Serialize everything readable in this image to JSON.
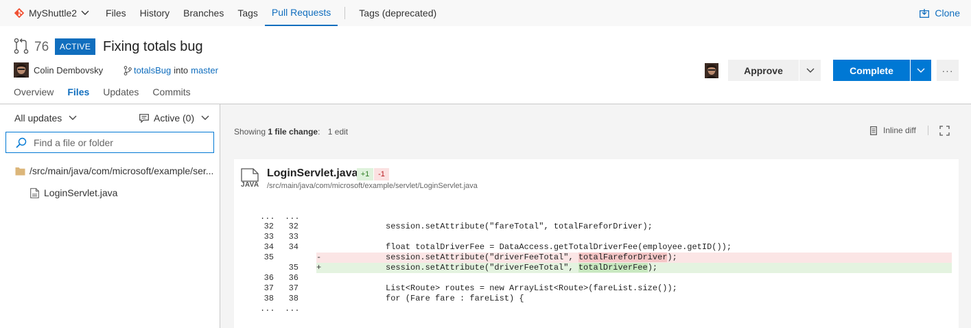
{
  "nav": {
    "project": "MyShuttle2",
    "items": [
      "Files",
      "History",
      "Branches",
      "Tags",
      "Pull Requests",
      "Tags (deprecated)"
    ],
    "active_index": 4,
    "clone_label": "Clone"
  },
  "pr": {
    "number": "76",
    "status": "ACTIVE",
    "title": "Fixing totals bug",
    "author": "Colin Dembovsky",
    "source_branch": "totalsBug",
    "into_label": "into",
    "target_branch": "master",
    "approve_label": "Approve",
    "complete_label": "Complete",
    "more_label": "···",
    "tabs": [
      "Overview",
      "Files",
      "Updates",
      "Commits"
    ],
    "selected_tab": 1
  },
  "left": {
    "updates_label": "All updates",
    "active_label": "Active (0)",
    "search_placeholder": "Find a file or folder",
    "folder_path": "/src/main/java/com/microsoft/example/ser...",
    "file_name": "LoginServlet.java"
  },
  "summary": {
    "showing_prefix": "Showing",
    "file_change": "1 file change",
    "colon": ":",
    "edits": "1 edit",
    "inline_diff_label": "Inline diff"
  },
  "diff": {
    "file_name": "LoginServlet.java",
    "file_type": "JAVA",
    "additions": "+1",
    "deletions": "-1",
    "file_path": "/src/main/java/com/microsoft/example/servlet/LoginServlet.java",
    "ellipsis": "...",
    "lines": [
      {
        "old": "32",
        "new": "32",
        "type": "ctx",
        "marker": "",
        "pre": "session.setAttribute(\"fareTotal\", totalFareforDriver);",
        "hl": "",
        "post": ""
      },
      {
        "old": "33",
        "new": "33",
        "type": "ctx",
        "marker": "",
        "pre": "",
        "hl": "",
        "post": ""
      },
      {
        "old": "34",
        "new": "34",
        "type": "ctx",
        "marker": "",
        "pre": "float totalDriverFee = DataAccess.getTotalDriverFee(employee.getID());",
        "hl": "",
        "post": ""
      },
      {
        "old": "35",
        "new": "",
        "type": "del",
        "marker": "-",
        "pre": "session.setAttribute(\"driverFeeTotal\", ",
        "hl": "totalFareforDriver",
        "post": ");"
      },
      {
        "old": "",
        "new": "35",
        "type": "add",
        "marker": "+",
        "pre": "session.setAttribute(\"driverFeeTotal\", ",
        "hl": "totalDriverFee",
        "post": ");"
      },
      {
        "old": "36",
        "new": "36",
        "type": "ctx",
        "marker": "",
        "pre": "",
        "hl": "",
        "post": ""
      },
      {
        "old": "37",
        "new": "37",
        "type": "ctx",
        "marker": "",
        "pre": "List<Route> routes = new ArrayList<Route>(fareList.size());",
        "hl": "",
        "post": ""
      },
      {
        "old": "38",
        "new": "38",
        "type": "ctx",
        "marker": "",
        "pre": "for (Fare fare : fareList) {",
        "hl": "",
        "post": ""
      }
    ]
  },
  "colors": {
    "accent": "#0078d4",
    "link": "#106ebe",
    "git_logo": "#f05033",
    "add_bg": "#e4f3e0",
    "del_bg": "#fbe5e5"
  }
}
